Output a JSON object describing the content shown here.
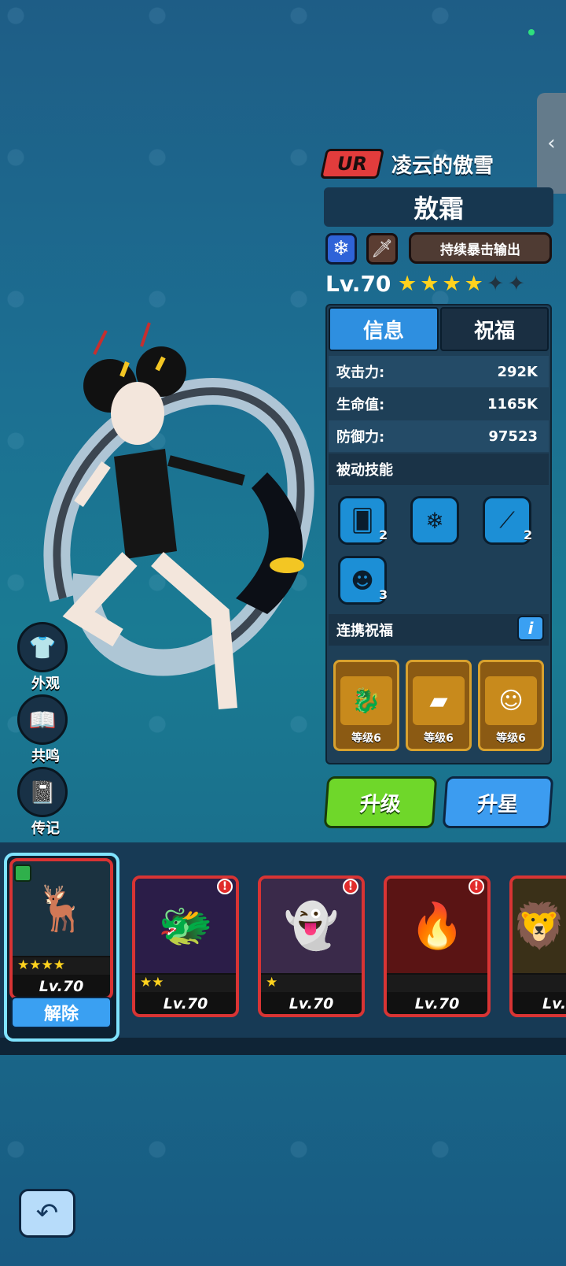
{
  "hero": {
    "rarity": "UR",
    "title": "凌云的傲雪",
    "name": "敖霜",
    "element_icon": "snowflake-icon",
    "role_icon": "sword-icon",
    "role_label": "持续暴击输出",
    "level": "Lv.70",
    "stars_filled": 4,
    "stars_total": 6
  },
  "tabs": {
    "info": "信息",
    "bless": "祝福"
  },
  "stats": [
    {
      "label": "攻击力:",
      "value": "292K"
    },
    {
      "label": "生命值:",
      "value": "1165K"
    },
    {
      "label": "防御力:",
      "value": "97523"
    }
  ],
  "passive_title": "被动技能",
  "passive_skills": [
    {
      "icon": "cards-icon",
      "level": "2"
    },
    {
      "icon": "snowflakes-icon",
      "level": ""
    },
    {
      "icon": "claw-icon",
      "level": "2"
    },
    {
      "icon": "demon-icon",
      "level": "3"
    }
  ],
  "link_title": "连携祝福",
  "link_info": "i",
  "link_cards": [
    {
      "icon": "dragon-icon",
      "level": "等级6"
    },
    {
      "icon": "gold-icon",
      "level": "等级6"
    },
    {
      "icon": "imp-icon",
      "level": "等级6"
    }
  ],
  "buttons": {
    "upgrade": "升级",
    "star_up": "升星",
    "remove": "解除"
  },
  "side_menu": [
    {
      "icon": "shirt-icon",
      "label": "外观"
    },
    {
      "icon": "book-icon",
      "label": "共鸣"
    },
    {
      "icon": "journal-icon",
      "label": "传记"
    }
  ],
  "roster": [
    {
      "portrait": "white-stag-icon",
      "level": "Lv.70",
      "stars": "★★★★",
      "alert": false,
      "selected": true
    },
    {
      "portrait": "blue-dragon-icon",
      "level": "Lv.70",
      "stars": "★★",
      "alert": true
    },
    {
      "portrait": "white-spirit-icon",
      "level": "Lv.70",
      "stars": "★",
      "alert": true
    },
    {
      "portrait": "red-dragon-icon",
      "level": "Lv.70",
      "stars": "",
      "alert": true
    },
    {
      "portrait": "gold-beast-icon",
      "level": "Lv.",
      "stars": "",
      "alert": false
    }
  ],
  "colors": {
    "accent_green": "#6fd72a",
    "accent_blue": "#3c9cf0",
    "rarity_red": "#e23c3c",
    "star_gold": "#ffd21e"
  }
}
